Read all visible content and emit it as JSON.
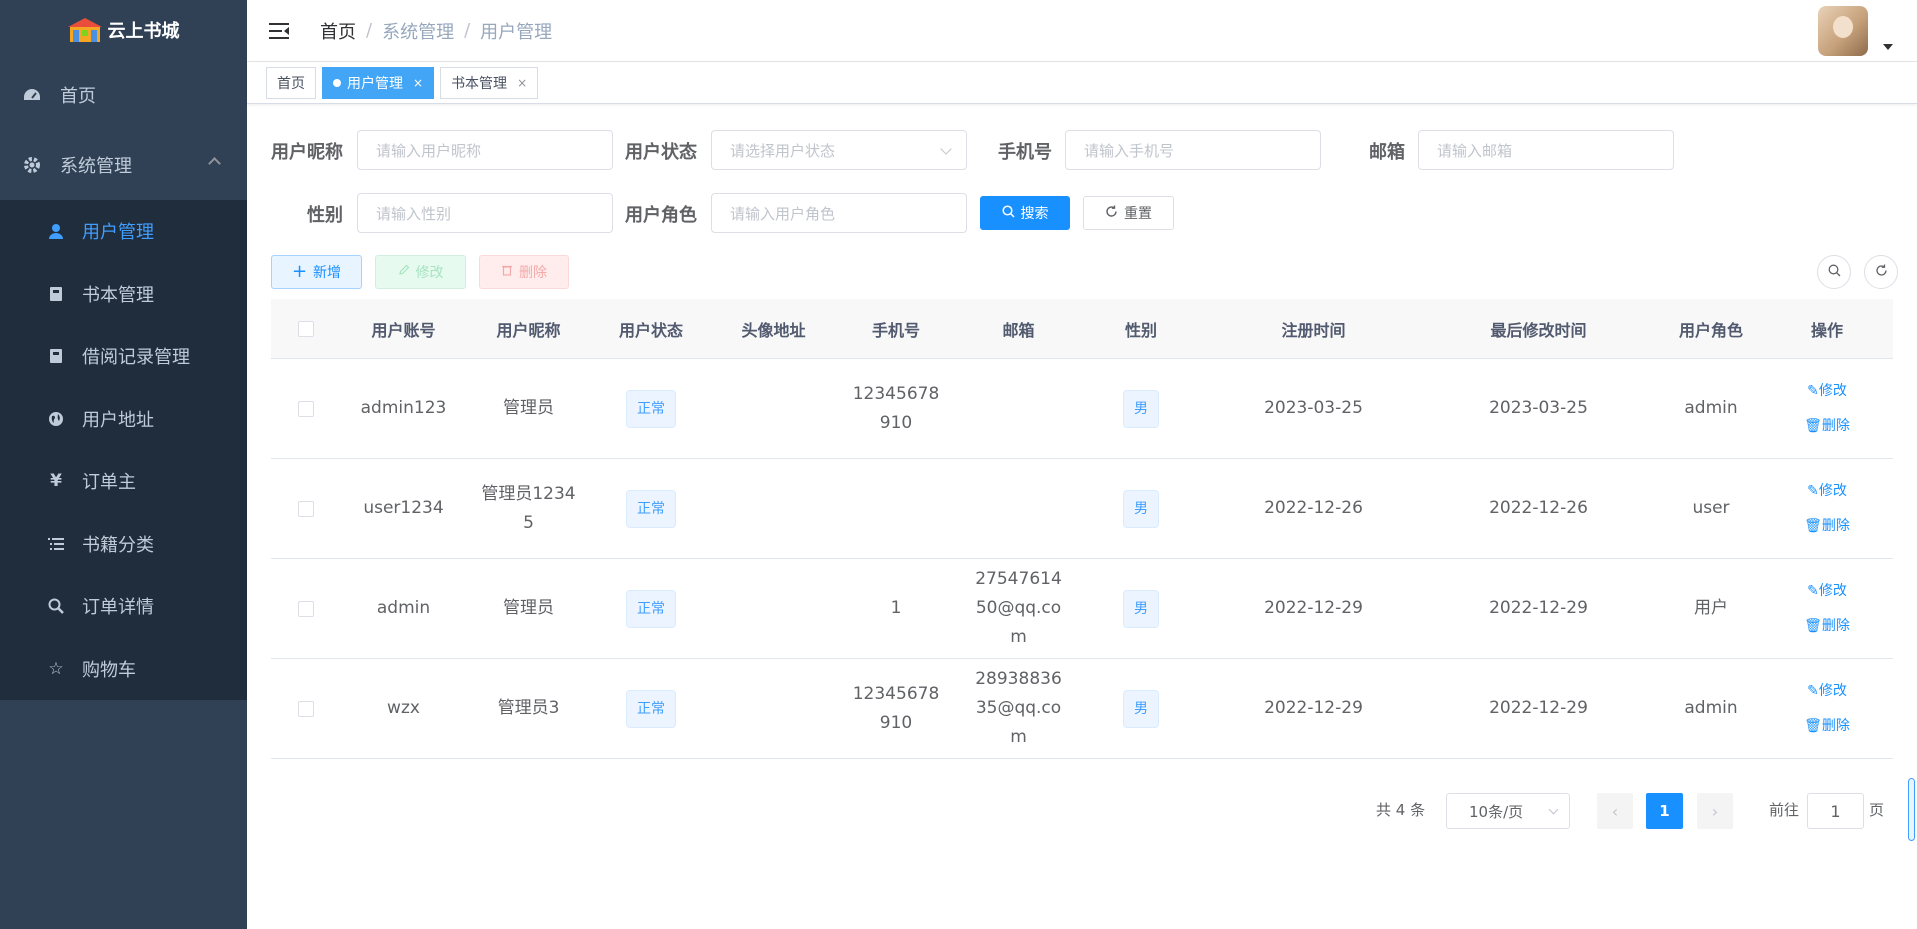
{
  "app": {
    "title": "云上书城"
  },
  "sidebar": {
    "items": [
      {
        "label": "首页",
        "icon": "dashboard-icon"
      },
      {
        "label": "系统管理",
        "icon": "gear-icon"
      }
    ],
    "sub_items": [
      {
        "label": "用户管理",
        "icon": "user-icon"
      },
      {
        "label": "书本管理",
        "icon": "book-icon"
      },
      {
        "label": "借阅记录管理",
        "icon": "book-icon"
      },
      {
        "label": "用户地址",
        "icon": "globe-icon"
      },
      {
        "label": "订单主",
        "icon": "yen-icon"
      },
      {
        "label": "书籍分类",
        "icon": "list-icon"
      },
      {
        "label": "订单详情",
        "icon": "search-icon"
      },
      {
        "label": "购物车",
        "icon": "star-icon"
      }
    ]
  },
  "breadcrumb": {
    "home": "首页",
    "level1": "系统管理",
    "level2": "用户管理"
  },
  "tags": [
    {
      "label": "首页"
    },
    {
      "label": "用户管理",
      "close": "×"
    },
    {
      "label": "书本管理",
      "close": "×"
    }
  ],
  "filters": {
    "nickname_label": "用户昵称",
    "nickname_placeholder": "请输入用户昵称",
    "status_label": "用户状态",
    "status_placeholder": "请选择用户状态",
    "phone_label": "手机号",
    "phone_placeholder": "请输入手机号",
    "email_label": "邮箱",
    "email_placeholder": "请输入邮箱",
    "gender_label": "性别",
    "gender_placeholder": "请输入性别",
    "role_label": "用户角色",
    "role_placeholder": "请输入用户角色",
    "search_label": "搜索",
    "reset_label": "重置"
  },
  "toolbar": {
    "add_label": "新增",
    "edit_label": "修改",
    "delete_label": "删除"
  },
  "table": {
    "headers": [
      "用户账号",
      "用户昵称",
      "用户状态",
      "头像地址",
      "手机号",
      "邮箱",
      "性别",
      "注册时间",
      "最后修改时间",
      "用户角色",
      "操作"
    ],
    "rows": [
      {
        "account": "admin123",
        "nickname": "管理员",
        "status": "正常",
        "avatar": "",
        "phone": "12345678910",
        "email": "",
        "gender": "男",
        "created": "2023-03-25",
        "updated": "2023-03-25",
        "role": "admin",
        "edit": "修改",
        "delete": "删除"
      },
      {
        "account": "user1234",
        "nickname": "管理员12345",
        "status": "正常",
        "avatar": "",
        "phone": "",
        "email": "",
        "gender": "男",
        "created": "2022-12-26",
        "updated": "2022-12-26",
        "role": "user",
        "edit": "修改",
        "delete": "删除"
      },
      {
        "account": "admin",
        "nickname": "管理员",
        "status": "正常",
        "avatar": "",
        "phone": "1",
        "email": "2754761450@qq.com",
        "gender": "男",
        "created": "2022-12-29",
        "updated": "2022-12-29",
        "role": "用户",
        "edit": "修改",
        "delete": "删除"
      },
      {
        "account": "wzx",
        "nickname": "管理员3",
        "status": "正常",
        "avatar": "",
        "phone": "12345678910",
        "email": "2893883635@qq.com",
        "gender": "男",
        "created": "2022-12-29",
        "updated": "2022-12-29",
        "role": "admin",
        "edit": "修改",
        "delete": "删除"
      }
    ]
  },
  "pagination": {
    "total": "共 4 条",
    "page_size": "10条/页",
    "current": "1",
    "goto_label": "前往",
    "goto_value": "1",
    "page_suffix": "页"
  }
}
